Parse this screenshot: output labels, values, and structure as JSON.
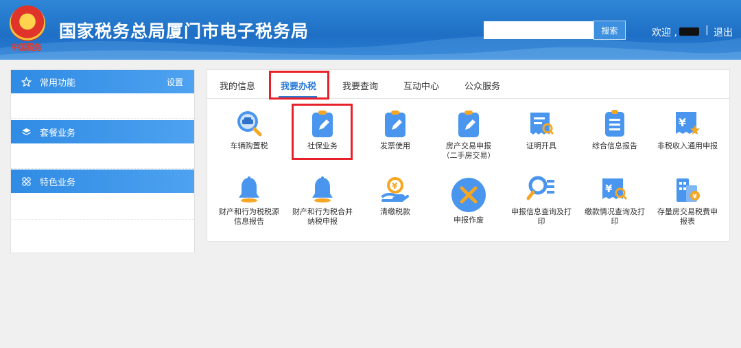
{
  "header": {
    "emblem_text": "中国税务",
    "title": "国家税务总局厦门市电子税务局",
    "search_placeholder": "",
    "search_button": "搜索",
    "welcome": "欢迎 ,",
    "separator": "|",
    "logout": "退出"
  },
  "sidebar": {
    "sections": [
      {
        "label": "常用功能",
        "icon": "star-icon",
        "action": "设置"
      },
      {
        "label": "套餐业务",
        "icon": "layers-icon"
      },
      {
        "label": "特色业务",
        "icon": "grid-icon"
      }
    ]
  },
  "tabs": [
    {
      "label": "我的信息"
    },
    {
      "label": "我要办税",
      "active": true
    },
    {
      "label": "我要查询"
    },
    {
      "label": "互动中心"
    },
    {
      "label": "公众服务"
    }
  ],
  "items_row1": [
    {
      "label": "车辆购置税",
      "icon": "car-search-icon"
    },
    {
      "label": "社保业务",
      "icon": "clipboard-edit-icon"
    },
    {
      "label": "发票使用",
      "icon": "clipboard-edit-icon"
    },
    {
      "label": "房产交易申报\n（二手房交易）",
      "icon": "clipboard-edit-icon"
    },
    {
      "label": "证明开具",
      "icon": "receipt-search-icon"
    },
    {
      "label": "综合信息报告",
      "icon": "document-list-icon"
    },
    {
      "label": "非税收入通用申报",
      "icon": "yuan-star-icon"
    }
  ],
  "items_row2": [
    {
      "label": "财产和行为税税源信息报告",
      "icon": "bell-icon"
    },
    {
      "label": "财产和行为税合并纳税申报",
      "icon": "bell-icon"
    },
    {
      "label": "清缴税款",
      "icon": "yuan-hand-icon"
    },
    {
      "label": "申报作废",
      "icon": "cancel-circle-icon"
    },
    {
      "label": "申报信息查询及打印",
      "icon": "search-list-icon"
    },
    {
      "label": "缴款情况查询及打印",
      "icon": "yuan-search-icon"
    },
    {
      "label": "存量房交易税费申报表",
      "icon": "building-yuan-icon"
    }
  ],
  "colors": {
    "header_blue": "#1e6fc5",
    "accent": "#2a7ad6",
    "highlight_red": "#e8202a",
    "icon_blue": "#4a96ee",
    "icon_orange": "#f5a623"
  }
}
